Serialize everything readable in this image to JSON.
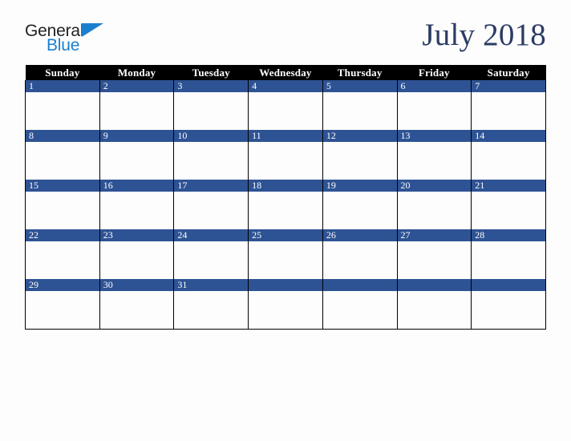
{
  "brand": {
    "word_one": "General",
    "word_two": "Blue",
    "triangle_icon": "triangle-icon",
    "accent_color": "#1b7fd0",
    "text_color": "#231f20"
  },
  "header": {
    "title": "July 2018",
    "title_color": "#2b3c64"
  },
  "calendar": {
    "month": "July",
    "year": "2018",
    "weekday_headers": [
      "Sunday",
      "Monday",
      "Tuesday",
      "Wednesday",
      "Thursday",
      "Friday",
      "Saturday"
    ],
    "header_background": "#000000",
    "header_text_color": "#ffffff",
    "date_bar_color": "#2e5394",
    "date_text_color": "#ffffff",
    "cell_background": "#fdfdfd",
    "grid_line_color": "#000000",
    "weeks": [
      [
        {
          "date": "1",
          "events": ""
        },
        {
          "date": "2",
          "events": ""
        },
        {
          "date": "3",
          "events": ""
        },
        {
          "date": "4",
          "events": ""
        },
        {
          "date": "5",
          "events": ""
        },
        {
          "date": "6",
          "events": ""
        },
        {
          "date": "7",
          "events": ""
        }
      ],
      [
        {
          "date": "8",
          "events": ""
        },
        {
          "date": "9",
          "events": ""
        },
        {
          "date": "10",
          "events": ""
        },
        {
          "date": "11",
          "events": ""
        },
        {
          "date": "12",
          "events": ""
        },
        {
          "date": "13",
          "events": ""
        },
        {
          "date": "14",
          "events": ""
        }
      ],
      [
        {
          "date": "15",
          "events": ""
        },
        {
          "date": "16",
          "events": ""
        },
        {
          "date": "17",
          "events": ""
        },
        {
          "date": "18",
          "events": ""
        },
        {
          "date": "19",
          "events": ""
        },
        {
          "date": "20",
          "events": ""
        },
        {
          "date": "21",
          "events": ""
        }
      ],
      [
        {
          "date": "22",
          "events": ""
        },
        {
          "date": "23",
          "events": ""
        },
        {
          "date": "24",
          "events": ""
        },
        {
          "date": "25",
          "events": ""
        },
        {
          "date": "26",
          "events": ""
        },
        {
          "date": "27",
          "events": ""
        },
        {
          "date": "28",
          "events": ""
        }
      ],
      [
        {
          "date": "29",
          "events": ""
        },
        {
          "date": "30",
          "events": ""
        },
        {
          "date": "31",
          "events": ""
        },
        {
          "date": "",
          "events": ""
        },
        {
          "date": "",
          "events": ""
        },
        {
          "date": "",
          "events": ""
        },
        {
          "date": "",
          "events": ""
        }
      ]
    ]
  }
}
